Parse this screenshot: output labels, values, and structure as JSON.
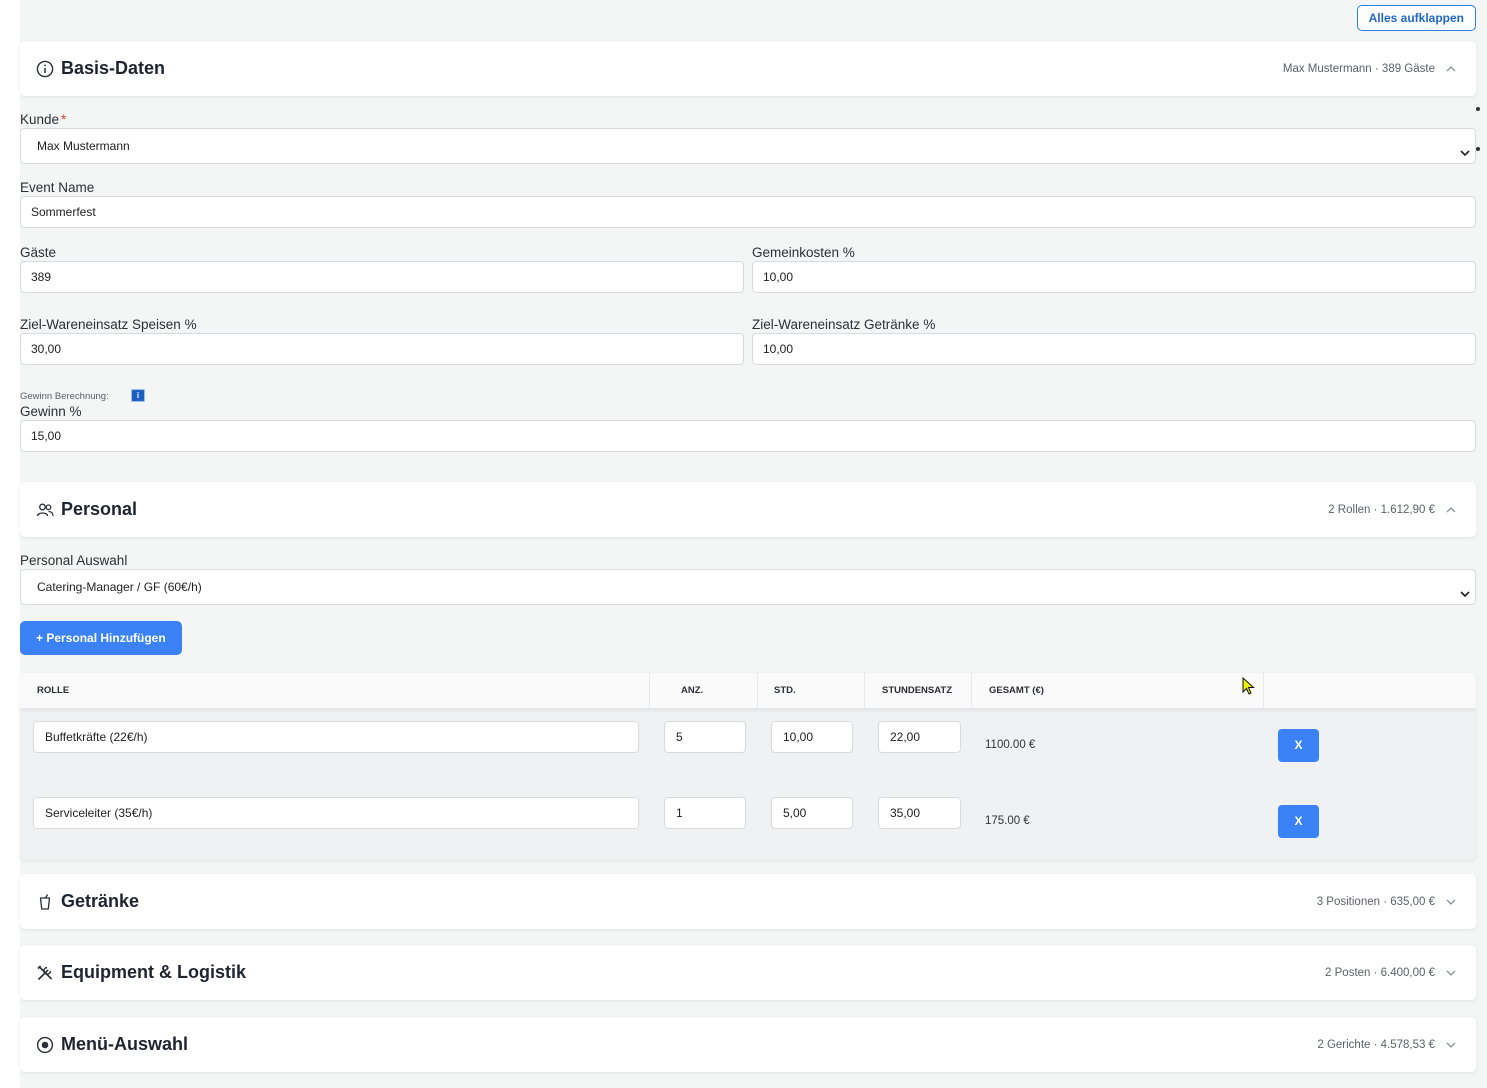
{
  "top_action": {
    "label": "Alles aufklappen"
  },
  "sections": {
    "basis": {
      "title": "Basis-Daten",
      "summary": "Max Mustermann · 389 Gäste",
      "icon": "info-circle-icon",
      "expanded": true
    },
    "personal": {
      "title": "Personal",
      "summary": "2 Rollen · 1.612,90 €",
      "icon": "users-icon",
      "expanded": true
    },
    "getraenke": {
      "title": "Getränke",
      "summary": "3 Positionen · 635,00 €",
      "icon": "cup-icon",
      "expanded": false
    },
    "equipment": {
      "title": "Equipment & Logistik",
      "summary": "2 Posten · 6.400,00 €",
      "icon": "tools-icon",
      "expanded": false
    },
    "menu": {
      "title": "Menü-Auswahl",
      "summary": "2 Gerichte · 4.578,53 €",
      "icon": "dish-icon",
      "expanded": false
    }
  },
  "basis_form": {
    "kunde": {
      "label": "Kunde",
      "required_mark": "*",
      "value": "Max Mustermann"
    },
    "event_name": {
      "label": "Event Name",
      "value": "Sommerfest"
    },
    "gaeste": {
      "label": "Gäste",
      "value": "389"
    },
    "gemeinkosten": {
      "label": "Gemeinkosten %",
      "value": "10,00"
    },
    "ziel_speisen": {
      "label": "Ziel-Wareneinsatz Speisen %",
      "value": "30,00"
    },
    "ziel_getraenke": {
      "label": "Ziel-Wareneinsatz Getränke %",
      "value": "10,00"
    },
    "gewinn_berechnung": {
      "label": "Gewinn Berechnung:",
      "info": "i"
    },
    "gewinn": {
      "label": "Gewinn %",
      "value": "15,00"
    }
  },
  "personal_form": {
    "auswahl": {
      "label": "Personal Auswahl",
      "value": "Catering-Manager / GF (60€/h)"
    },
    "add_button": "+ Personal Hinzufügen",
    "columns": [
      "ROLLE",
      "ANZ.",
      "STD.",
      "STUNDENSATZ",
      "GESAMT (€)"
    ],
    "rows": [
      {
        "rolle": "Buffetkräfte (22€/h)",
        "anz": "5",
        "std": "10,00",
        "satz": "22,00",
        "gesamt": "1100.00 €",
        "remove": "X"
      },
      {
        "rolle": "Serviceleiter (35€/h)",
        "anz": "1",
        "std": "5,00",
        "satz": "35,00",
        "gesamt": "175.00 €",
        "remove": "X"
      }
    ]
  }
}
